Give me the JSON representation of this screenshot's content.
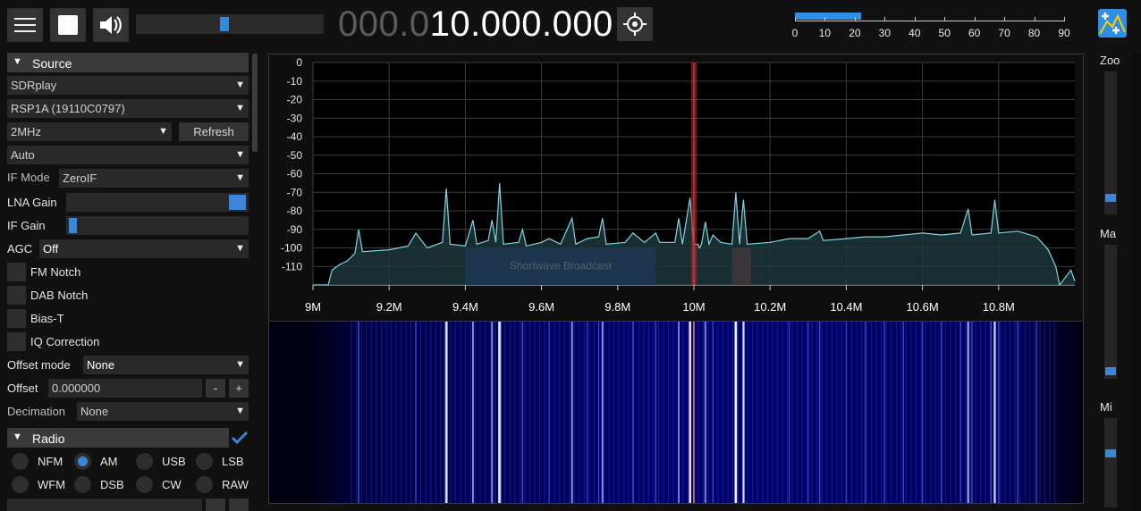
{
  "toolbar": {
    "frequency_dim": "000.0",
    "frequency_bright": "10.000.000",
    "volume_level": 0.47,
    "snr_scale": [
      "0",
      "10",
      "20",
      "30",
      "40",
      "50",
      "60",
      "70",
      "80",
      "90"
    ],
    "snr_value": 22
  },
  "source": {
    "title": "Source",
    "device": "SDRplay",
    "serial": "RSP1A (19110C0797)",
    "samplerate": "2MHz",
    "refresh_label": "Refresh",
    "antenna": "Auto",
    "if_mode_label": "IF Mode",
    "if_mode_value": "ZeroIF",
    "lna_gain_label": "LNA Gain",
    "lna_gain_level": 1.0,
    "if_gain_label": "IF Gain",
    "if_gain_level": 0.0,
    "agc_label": "AGC",
    "agc_value": "Off",
    "fm_notch": "FM Notch",
    "dab_notch": "DAB Notch",
    "bias_t": "Bias-T",
    "iq_correction": "IQ Correction",
    "offset_mode_label": "Offset mode",
    "offset_mode_value": "None",
    "offset_label": "Offset",
    "offset_value": "0.000000",
    "offset_minus": "-",
    "offset_plus": "+",
    "decimation_label": "Decimation",
    "decimation_value": "None"
  },
  "radio": {
    "title": "Radio",
    "modes": [
      "NFM",
      "AM",
      "USB",
      "LSB",
      "WFM",
      "DSB",
      "CW",
      "RAW"
    ],
    "selected": "AM"
  },
  "right_panel": {
    "zoom_label": "Zoo",
    "max_label": "Ma",
    "min_label": "Mi"
  },
  "colors": {
    "accent": "#3a86d8",
    "spectrum_line": "#7fd5e6",
    "spectrum_fill": "#1f3a3c",
    "vfo_band": "#1c2da8",
    "vfo_marker": "#b0282c",
    "waterfall_bg": "#00006e"
  },
  "chart_data": {
    "type": "line",
    "x_unit": "MHz",
    "xlim": [
      9.0,
      11.0
    ],
    "ylim": [
      -120,
      0
    ],
    "x_ticks": [
      "9M",
      "9.2M",
      "9.4M",
      "9.6M",
      "9.8M",
      "10M",
      "10.2M",
      "10.4M",
      "10.6M",
      "10.8M"
    ],
    "y_ticks": [
      "0",
      "-10",
      "-20",
      "-30",
      "-40",
      "-50",
      "-60",
      "-70",
      "-80",
      "-90",
      "-100",
      "-110"
    ],
    "series": [
      {
        "points": [
          [
            9.0,
            -120
          ],
          [
            9.04,
            -120
          ],
          [
            9.05,
            -112
          ],
          [
            9.07,
            -109
          ],
          [
            9.09,
            -107
          ],
          [
            9.11,
            -103
          ],
          [
            9.12,
            -90
          ],
          [
            9.13,
            -102
          ],
          [
            9.2,
            -101
          ],
          [
            9.25,
            -99
          ],
          [
            9.27,
            -92
          ],
          [
            9.3,
            -100
          ],
          [
            9.34,
            -97
          ],
          [
            9.35,
            -68
          ],
          [
            9.36,
            -98
          ],
          [
            9.4,
            -99
          ],
          [
            9.42,
            -85
          ],
          [
            9.43,
            -98
          ],
          [
            9.46,
            -96
          ],
          [
            9.47,
            -85
          ],
          [
            9.48,
            -97
          ],
          [
            9.49,
            -65
          ],
          [
            9.5,
            -98
          ],
          [
            9.54,
            -97
          ],
          [
            9.55,
            -90
          ],
          [
            9.56,
            -99
          ],
          [
            9.6,
            -97
          ],
          [
            9.62,
            -95
          ],
          [
            9.65,
            -98
          ],
          [
            9.68,
            -84
          ],
          [
            9.69,
            -98
          ],
          [
            9.72,
            -95
          ],
          [
            9.75,
            -94
          ],
          [
            9.76,
            -84
          ],
          [
            9.77,
            -98
          ],
          [
            9.82,
            -97
          ],
          [
            9.84,
            -92
          ],
          [
            9.87,
            -97
          ],
          [
            9.9,
            -92
          ],
          [
            9.91,
            -97
          ],
          [
            9.95,
            -97
          ],
          [
            9.96,
            -84
          ],
          [
            9.97,
            -98
          ],
          [
            9.99,
            -73
          ],
          [
            10.0,
            -98
          ],
          [
            10.01,
            -98
          ],
          [
            10.015,
            -100
          ],
          [
            10.02,
            -98
          ],
          [
            10.03,
            -86
          ],
          [
            10.04,
            -98
          ],
          [
            10.05,
            -93
          ],
          [
            10.07,
            -97
          ],
          [
            10.1,
            -98
          ],
          [
            10.11,
            -70
          ],
          [
            10.12,
            -98
          ],
          [
            10.13,
            -74
          ],
          [
            10.14,
            -98
          ],
          [
            10.2,
            -97
          ],
          [
            10.25,
            -95
          ],
          [
            10.3,
            -95
          ],
          [
            10.33,
            -91
          ],
          [
            10.34,
            -96
          ],
          [
            10.4,
            -95
          ],
          [
            10.45,
            -94
          ],
          [
            10.5,
            -94
          ],
          [
            10.55,
            -93
          ],
          [
            10.6,
            -92
          ],
          [
            10.65,
            -93
          ],
          [
            10.7,
            -92
          ],
          [
            10.72,
            -79
          ],
          [
            10.73,
            -93
          ],
          [
            10.78,
            -92
          ],
          [
            10.79,
            -74
          ],
          [
            10.8,
            -92
          ],
          [
            10.85,
            -91
          ],
          [
            10.9,
            -94
          ],
          [
            10.93,
            -101
          ],
          [
            10.95,
            -110
          ],
          [
            10.96,
            -120
          ],
          [
            10.99,
            -112
          ],
          [
            11.0,
            -118
          ]
        ]
      }
    ],
    "vfo": {
      "name": "Shortwave Broadcast",
      "start": 9.4,
      "end": 9.9
    },
    "vfo_secondary": {
      "start": 10.1,
      "end": 10.15
    },
    "center_marker": 10.0
  }
}
